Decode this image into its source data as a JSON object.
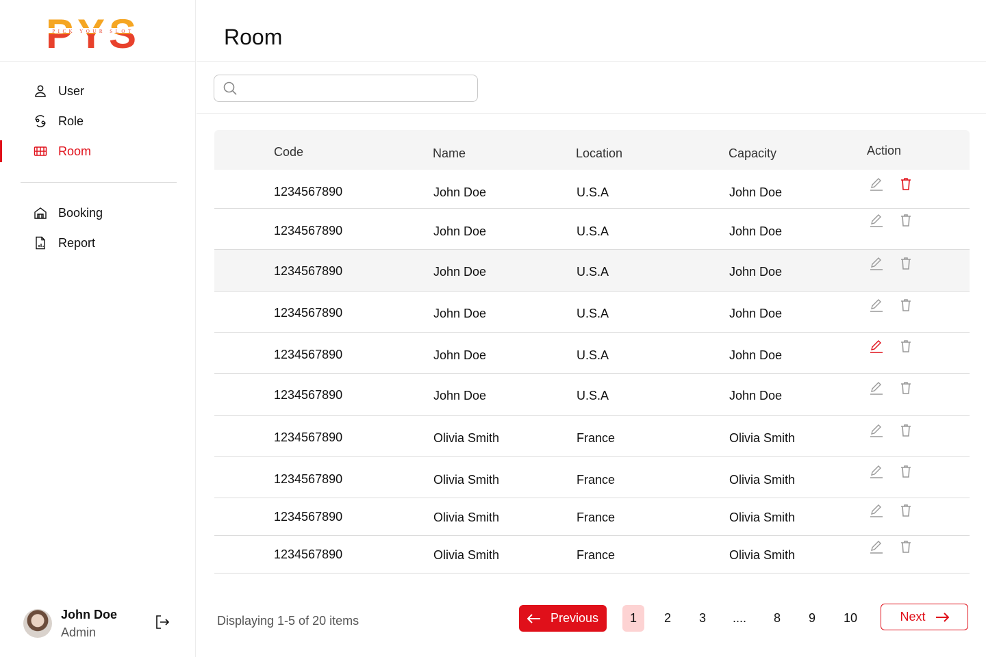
{
  "app": {
    "logo_text": "PYS",
    "logo_tagline": "PICK YOUR SLOT"
  },
  "sidebar": {
    "items": [
      {
        "label": "User",
        "icon": "user-icon"
      },
      {
        "label": "Role",
        "icon": "role-icon"
      },
      {
        "label": "Room",
        "icon": "room-icon",
        "active": true
      },
      {
        "label": "Booking",
        "icon": "building-icon"
      },
      {
        "label": "Report",
        "icon": "report-icon"
      }
    ],
    "user": {
      "name": "John Doe",
      "role": "Admin"
    }
  },
  "header": {
    "title": "Room"
  },
  "search": {
    "placeholder": "",
    "value": ""
  },
  "table": {
    "columns": [
      "Code",
      "Name",
      "Location",
      "Capacity",
      "Action"
    ],
    "rows": [
      {
        "code": "1234567890",
        "name": "John Doe",
        "location": "U.S.A",
        "capacity": "John Doe"
      },
      {
        "code": "1234567890",
        "name": "John Doe",
        "location": "U.S.A",
        "capacity": "John Doe"
      },
      {
        "code": "1234567890",
        "name": "John Doe",
        "location": "U.S.A",
        "capacity": "John Doe"
      },
      {
        "code": "1234567890",
        "name": "John Doe",
        "location": "U.S.A",
        "capacity": "John Doe"
      },
      {
        "code": "1234567890",
        "name": "John Doe",
        "location": "U.S.A",
        "capacity": "John Doe"
      },
      {
        "code": "1234567890",
        "name": "John Doe",
        "location": "U.S.A",
        "capacity": "John Doe"
      },
      {
        "code": "1234567890",
        "name": "Olivia Smith",
        "location": "France",
        "capacity": "Olivia Smith"
      },
      {
        "code": "1234567890",
        "name": "Olivia Smith",
        "location": "France",
        "capacity": "Olivia Smith"
      },
      {
        "code": "1234567890",
        "name": "Olivia Smith",
        "location": "France",
        "capacity": "Olivia Smith"
      },
      {
        "code": "1234567890",
        "name": "Olivia Smith",
        "location": "France",
        "capacity": "Olivia Smith"
      }
    ]
  },
  "pagination": {
    "info": "Displaying 1-5 of 20 items",
    "previous_label": "Previous",
    "next_label": "Next",
    "pages": [
      "1",
      "2",
      "3",
      "....",
      "8",
      "9",
      "10"
    ],
    "current": "1"
  },
  "colors": {
    "accent": "#e0101a",
    "active_page_bg": "#fdd3d3",
    "icon_gray": "#9a9a9a",
    "logo_orange": "#f5a623",
    "logo_red": "#e8412c"
  }
}
